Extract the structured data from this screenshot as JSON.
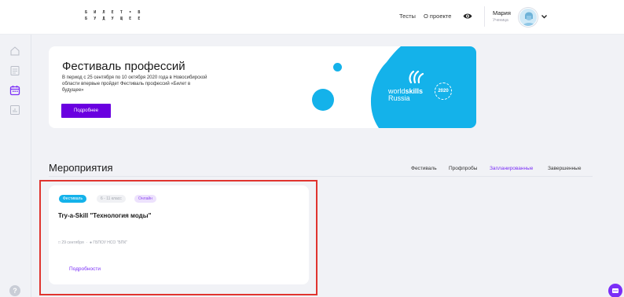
{
  "header": {
    "logo": [
      "Б И Л Е Т • В",
      "Б У Д У Щ Е Е"
    ],
    "nav": {
      "tests": "Тесты",
      "about": "О проекте"
    },
    "user": {
      "name": "Мария",
      "role": "Ученица"
    }
  },
  "sidebar": {
    "items": [
      "home-icon",
      "document-icon",
      "calendar-icon",
      "chart-icon"
    ],
    "active": "calendar-icon",
    "help": "?"
  },
  "banner": {
    "title": "Фестиваль профессий",
    "text": "В период с 25 сентября по 10 октября 2020 года в Новосибирской области впервые пройдет Фестиваль профессий «Билет в будущее»",
    "button": "Подробнее",
    "logo_line1_light": "world",
    "logo_line1_bold": "skills",
    "logo_line2": "Russia",
    "logo_year": "2020"
  },
  "events": {
    "title": "Мероприятия",
    "tabs": [
      "Фестиваль",
      "Профпробы",
      "Запланированные",
      "Завершенные"
    ],
    "active_tab": "Запланированные",
    "card": {
      "badges": [
        "Фестиваль",
        "6 - 11 класс",
        "Онлайн"
      ],
      "title": "Try-a-Skill \"Технология моды\"",
      "date": "29 сентября",
      "place": "ГБПОУ НСО \"БПК\"",
      "link": "Подробности"
    }
  },
  "colors": {
    "accent": "#7b2ff7",
    "button": "#6a00e0",
    "blue": "#14b2ea",
    "highlight": "#e0342f"
  }
}
